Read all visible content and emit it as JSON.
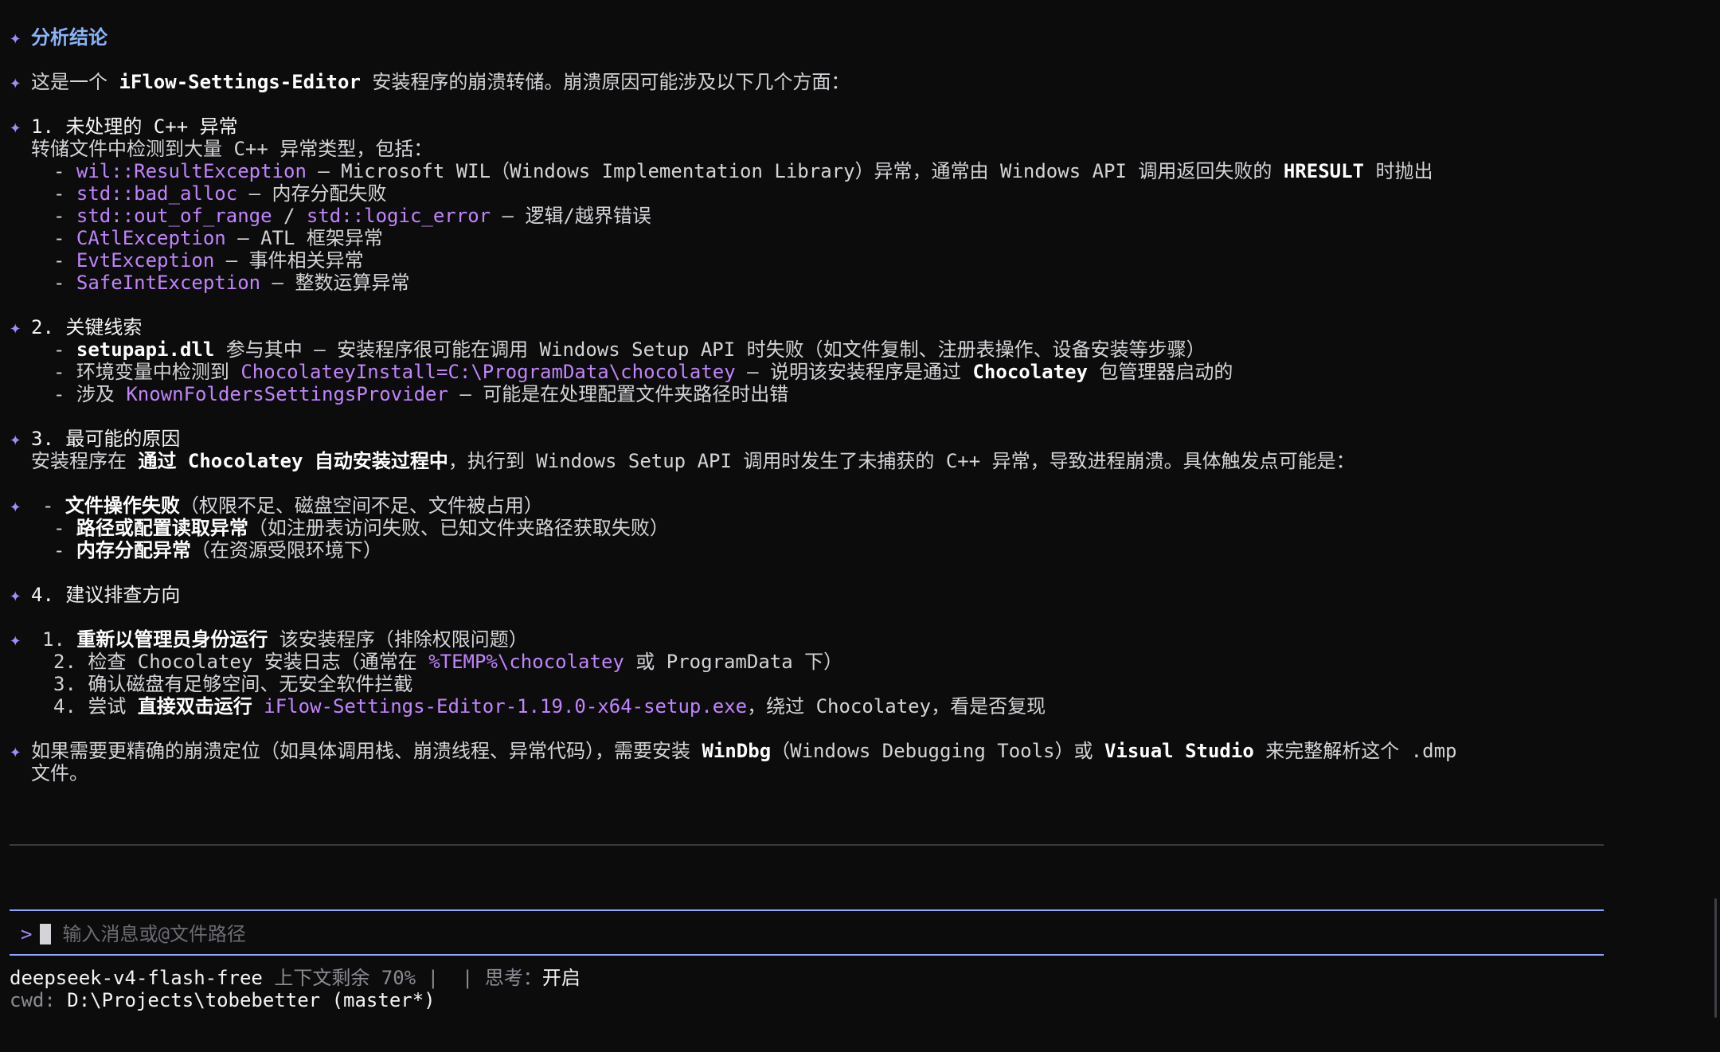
{
  "title": "分析结论",
  "intro": {
    "a": "这是一个 ",
    "b": "iFlow-Settings-Editor",
    "c": " 安装程序的崩溃转储。崩溃原因可能涉及以下几个方面："
  },
  "s1": {
    "head": "1. 未处理的 C++ 异常",
    "desc": "转储文件中检测到大量 C++ 异常类型，包括：",
    "i1": {
      "code": "wil::ResultException",
      "a": " – Microsoft WIL（Windows Implementation Library）异常，通常由 Windows API 调用返回失败的 ",
      "b": "HRESULT",
      "c": " 时抛出"
    },
    "i2": {
      "code": "std::bad_alloc",
      "a": " – 内存分配失败"
    },
    "i3": {
      "code1": "std::out_of_range",
      "sep": " / ",
      "code2": "std::logic_error",
      "a": " – 逻辑/越界错误"
    },
    "i4": {
      "code": "CAtlException",
      "a": " – ATL 框架异常"
    },
    "i5": {
      "code": "EvtException",
      "a": " – 事件相关异常"
    },
    "i6": {
      "code": "SafeIntException",
      "a": " – 整数运算异常"
    }
  },
  "s2": {
    "head": "2. 关键线索",
    "i1": {
      "bold": "setupapi.dll",
      "a": " 参与其中 – 安装程序很可能在调用 Windows Setup API 时失败（如文件复制、注册表操作、设备安装等步骤）"
    },
    "i2": {
      "a": "环境变量中检测到 ",
      "code": "ChocolateyInstall=C:\\ProgramData\\chocolatey",
      "b": " – 说明该安装程序是通过 ",
      "bold": "Chocolatey",
      "c": " 包管理器启动的"
    },
    "i3": {
      "a": "涉及 ",
      "code": "KnownFoldersSettingsProvider",
      "b": " – 可能是在处理配置文件夹路径时出错"
    }
  },
  "s3": {
    "head": "3. 最可能的原因",
    "a": "安装程序在 ",
    "bold": "通过 Chocolatey 自动安装过程中",
    "b": "，执行到 Windows Setup API 调用时发生了未捕获的 C++ 异常，导致进程崩溃。具体触发点可能是：",
    "l1": {
      "bold": "文件操作失败",
      "a": "（权限不足、磁盘空间不足、文件被占用）"
    },
    "l2": {
      "bold": "路径或配置读取异常",
      "a": "（如注册表访问失败、已知文件夹路径获取失败）"
    },
    "l3": {
      "bold": "内存分配异常",
      "a": "（在资源受限环境下）"
    }
  },
  "s4": {
    "head": "4. 建议排查方向",
    "l1": {
      "n": "1. ",
      "bold": "重新以管理员身份运行",
      "a": " 该安装程序（排除权限问题）"
    },
    "l2": {
      "n": "2. ",
      "a": "检查 Chocolatey 安装日志（通常在 ",
      "code": "%TEMP%\\chocolatey",
      "b": " 或 ProgramData 下）"
    },
    "l3": {
      "n": "3. ",
      "a": "确认磁盘有足够空间、无安全软件拦截"
    },
    "l4": {
      "n": "4. ",
      "a": "尝试 ",
      "bold": "直接双击运行",
      "b": " ",
      "code": "iFlow-Settings-Editor-1.19.0-x64-setup.exe",
      "c": "，绕过 Chocolatey，看是否复现"
    }
  },
  "final": {
    "a": "如果需要更精确的崩溃定位（如具体调用栈、崩溃线程、异常代码），需要安装 ",
    "bold1": "WinDbg",
    "b": "（Windows Debugging Tools）或 ",
    "bold2": "Visual Studio",
    "c": " 来完整解析这个 .dmp",
    "d": "文件。"
  },
  "input": {
    "prompt": ">",
    "placeholder": "输入消息或@文件路径"
  },
  "status": {
    "model": "deepseek-v4-flash-free",
    "context": " 上下文剩余 70% |  | 思考：",
    "thinking": "开启",
    "cwd_label": "cwd:",
    "cwd": " D:\\Projects\\tobebetter (master*)"
  },
  "colors": {
    "accent": "#a78bfa",
    "code": "#c084fc",
    "heading": "#8ab4f8",
    "input_border": "#8fa8ff",
    "bg": "#0c0c0c"
  }
}
